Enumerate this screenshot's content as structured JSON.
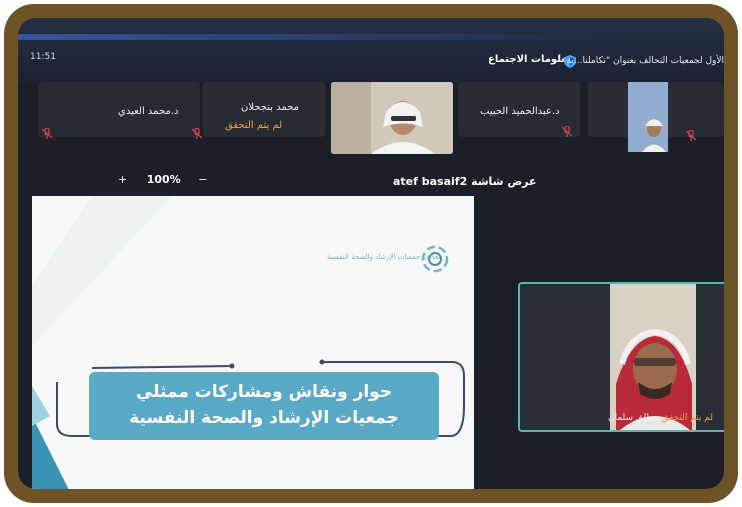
{
  "header": {
    "clock": "11:51",
    "meeting_title": "الأول لجمعيات التحالف بعنوان \"تكاملنا...ية",
    "meeting_info_label": "معلومات الاجتماع"
  },
  "participants": [
    {
      "name": "د.محمد العيدي",
      "status": ""
    },
    {
      "name": "محمد بنجحلان",
      "status": "لم يتم التحقق"
    },
    {
      "name": "د.عبدالحميد الحبيب",
      "status": ""
    }
  ],
  "share": {
    "zoom_out": "−",
    "zoom_level": "100%",
    "zoom_in": "+",
    "label": "عرض شاشة atef basaif2"
  },
  "slide": {
    "logo_text": "تحالف جمعيات الإرشاد والصحة النفسية",
    "line1": "حوار ونقاش ومشاركات ممثلي",
    "line2": "جمعيات الإرشاد والصحة النفسية"
  },
  "speaker": {
    "name": "مطلق سلمان",
    "status": "لم يتم التحقق"
  },
  "colors": {
    "frame": "#6e5326",
    "banner": "#5aa9c6",
    "status_orange": "#f0a03a",
    "speaker_border": "#56b8b0"
  }
}
